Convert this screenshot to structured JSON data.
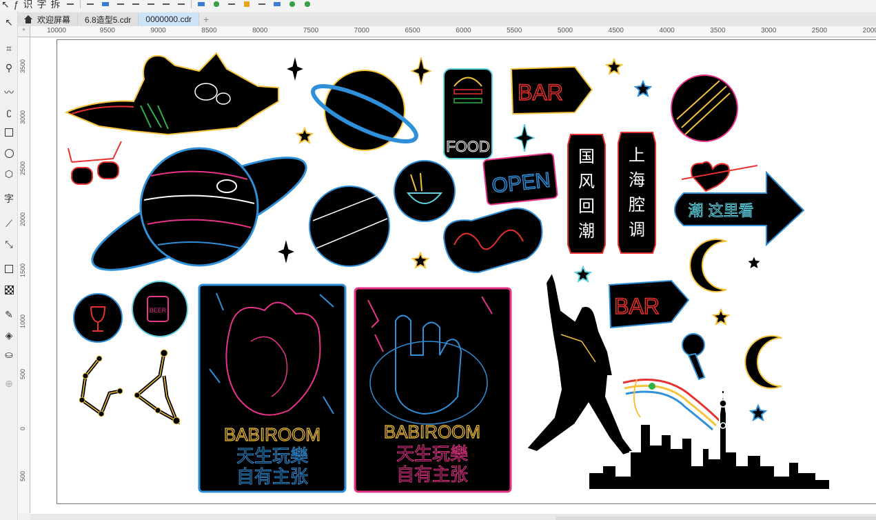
{
  "toolbar": {
    "chars": [
      "识",
      "字",
      "拆"
    ]
  },
  "tabs": [
    {
      "label": "欢迎屏幕",
      "home": true
    },
    {
      "label": "6.8造型5.cdr",
      "home": false
    },
    {
      "label": "0000000.cdr",
      "home": false,
      "active": true
    }
  ],
  "add_tab": "+",
  "toolbox": {
    "text_tool": "字"
  },
  "ruler_h": [
    "10000",
    "9500",
    "9000",
    "8500",
    "8000",
    "7500",
    "7000",
    "6500",
    "6000",
    "5500",
    "5000",
    "4500",
    "4000",
    "3500",
    "3000",
    "2500",
    "2000"
  ],
  "ruler_v": [
    "3500",
    "3000",
    "2500",
    "2000",
    "1500",
    "1000",
    "500",
    "0",
    "500"
  ],
  "artwork": {
    "neon_food": "FOOD",
    "bar_sign": "BAR",
    "open_sign": "OPEN",
    "vertical_sign_1": [
      "国",
      "风",
      "回",
      "潮"
    ],
    "vertical_sign_2": [
      "上",
      "海",
      "腔",
      "调"
    ],
    "arrow_sign": "潮 这里看",
    "beer_badge": "BEER",
    "babiroom": "BABIROOM",
    "slogan_line1": "天生玩樂",
    "slogan_line2": "自有主张",
    "colors": {
      "black": "#000000",
      "yellow": "#f5c33b",
      "blue": "#2f8fd8",
      "pink": "#e8338a",
      "red": "#e8312f",
      "cyan": "#5fd0e0",
      "green": "#2fb24a"
    }
  }
}
